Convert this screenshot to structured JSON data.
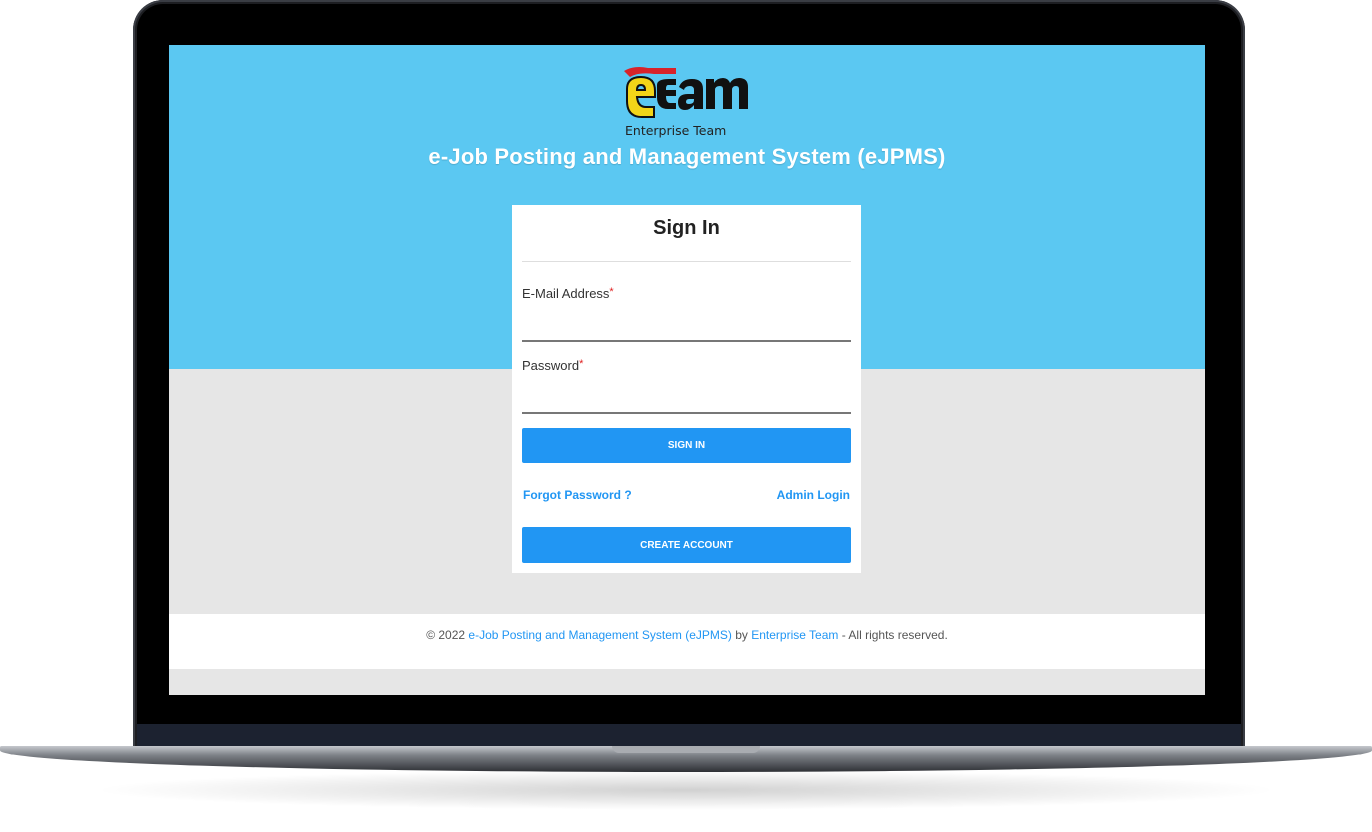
{
  "app": {
    "logo_text": "eTeam",
    "logo_tagline": "Enterprise Team",
    "title": "e-Job Posting and Management System (eJPMS)"
  },
  "signin": {
    "heading": "Sign In",
    "email_label": "E-Mail Address",
    "email_value": "",
    "password_label": "Password",
    "password_value": "",
    "required_marker": "*",
    "signin_button": "SIGN IN",
    "forgot_link": "Forgot Password ?",
    "admin_link": "Admin Login",
    "create_button": "CREATE ACCOUNT"
  },
  "footer": {
    "copyright_prefix": "© 2022",
    "system_link": "e-Job Posting and Management System (eJPMS)",
    "by_text": "by",
    "team_link": "Enterprise Team",
    "suffix": "- All rights reserved."
  },
  "colors": {
    "hero": "#5bc8f2",
    "accent": "#2196f3",
    "page_bg": "#e6e6e6",
    "required": "#e02020"
  }
}
